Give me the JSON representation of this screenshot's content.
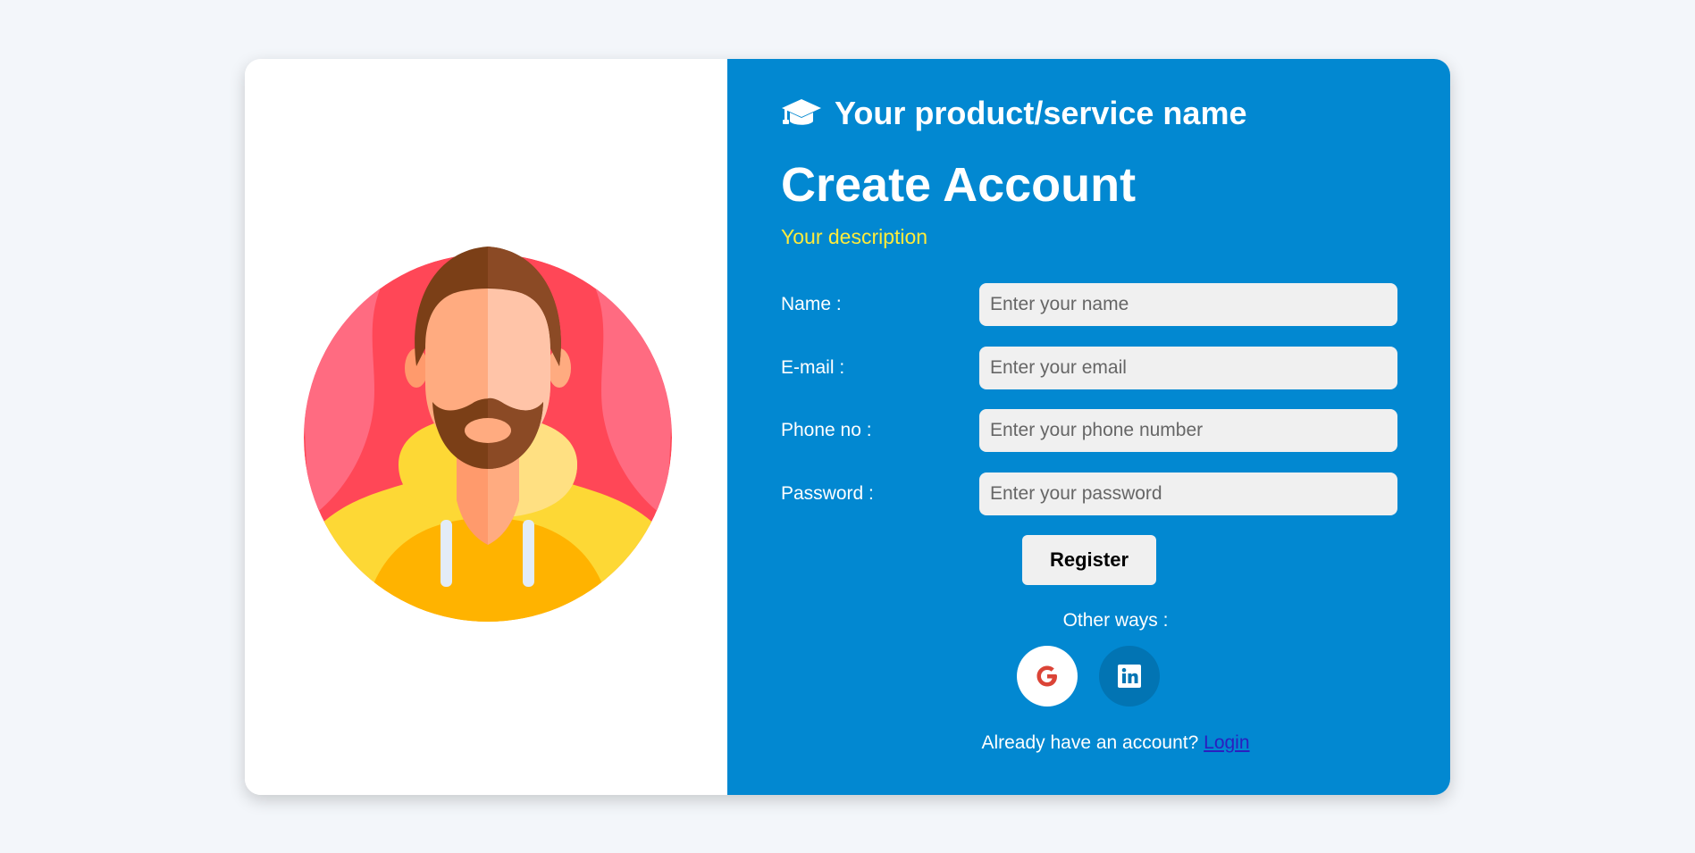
{
  "brand": {
    "name": "Your product/service name",
    "icon": "graduation-cap-icon"
  },
  "form": {
    "title": "Create Account",
    "description": "Your description",
    "fields": [
      {
        "label": "Name :",
        "placeholder": "Enter your name"
      },
      {
        "label": "E-mail :",
        "placeholder": "Enter your email"
      },
      {
        "label": "Phone no :",
        "placeholder": "Enter your phone number"
      },
      {
        "label": "Password :",
        "placeholder": "Enter your password"
      }
    ],
    "register_label": "Register",
    "other_ways_label": "Other ways :",
    "socials": [
      {
        "name": "google-icon",
        "color": "#db4437"
      },
      {
        "name": "linkedin-icon",
        "color": "#0274b3"
      }
    ],
    "already_text": "Already have an account?",
    "login_label": "Login"
  },
  "colors": {
    "page_bg": "#f3f6fa",
    "panel_bg": "#0288d1",
    "description": "#ffeb3b"
  }
}
